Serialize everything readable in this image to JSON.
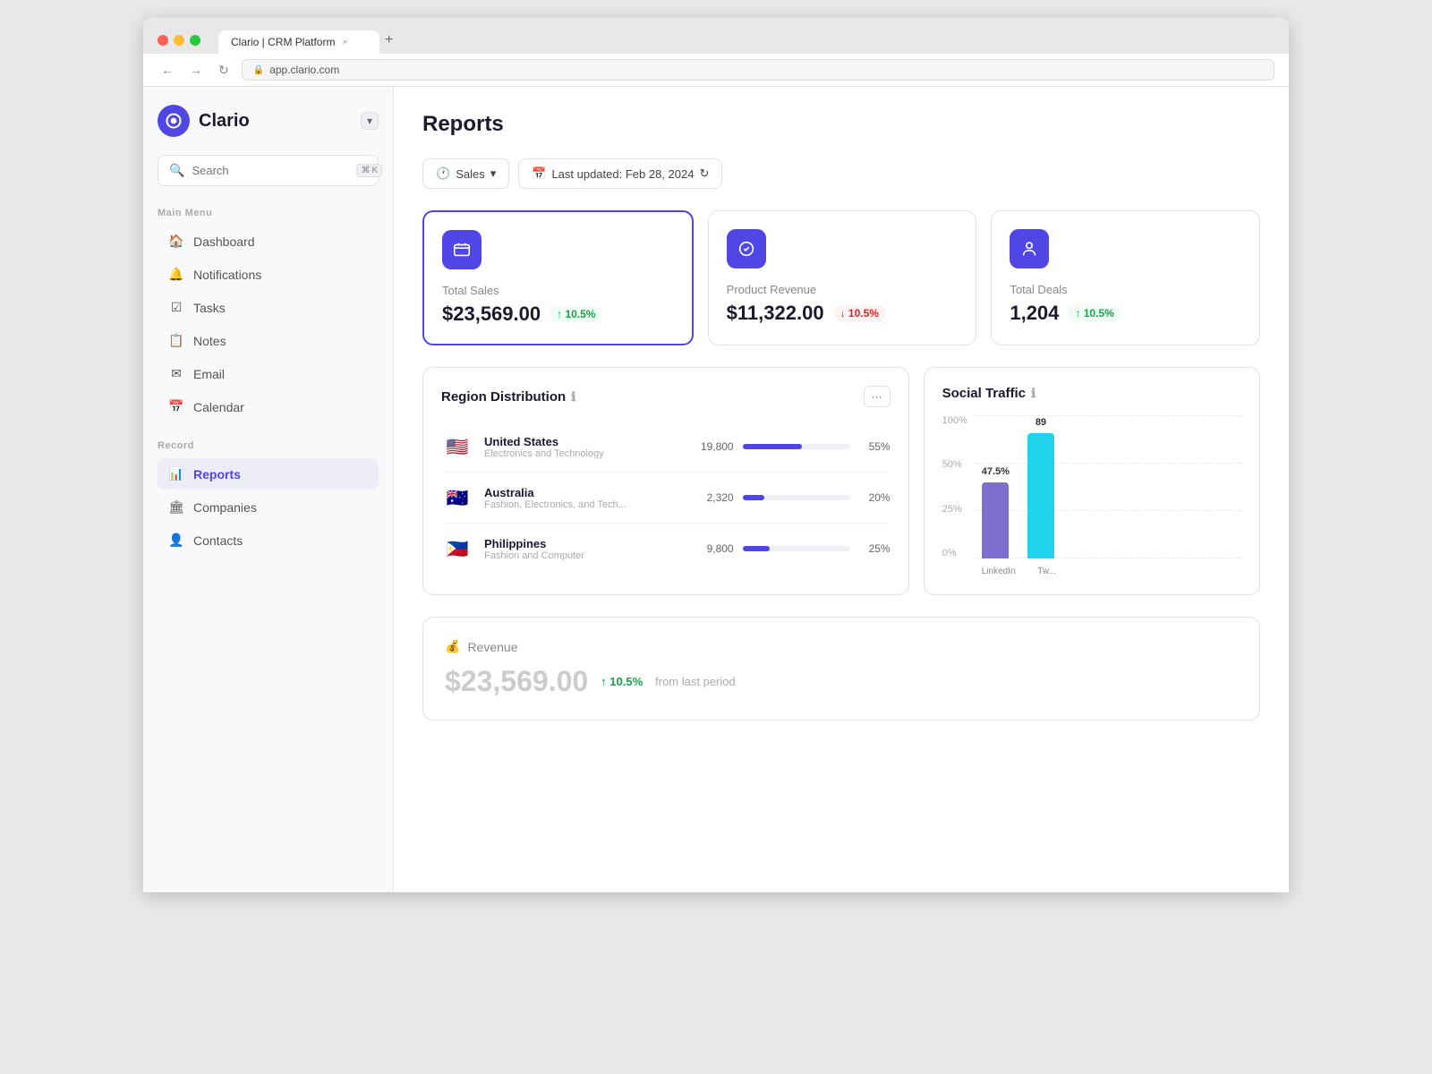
{
  "browser": {
    "tab_title": "Clario | CRM Platform",
    "tab_new_symbol": "+",
    "close_symbol": "×",
    "nav_back": "←",
    "nav_forward": "→",
    "nav_refresh": "↻",
    "address": "app.clario.com"
  },
  "sidebar": {
    "app_name": "Clario",
    "dropdown_symbol": "▾",
    "search_placeholder": "Search",
    "search_shortcut_cmd": "⌘",
    "search_shortcut_key": "K",
    "main_menu_label": "Main Menu",
    "record_label": "Record",
    "nav_items": [
      {
        "id": "dashboard",
        "label": "Dashboard",
        "icon": "🏠"
      },
      {
        "id": "notifications",
        "label": "Notifications",
        "icon": "🔔"
      },
      {
        "id": "tasks",
        "label": "Tasks",
        "icon": "☑"
      },
      {
        "id": "notes",
        "label": "Notes",
        "icon": "📋"
      },
      {
        "id": "email",
        "label": "Email",
        "icon": "✉"
      },
      {
        "id": "calendar",
        "label": "Calendar",
        "icon": "📅"
      }
    ],
    "record_items": [
      {
        "id": "reports",
        "label": "Reports",
        "icon": "📊",
        "active": true
      },
      {
        "id": "companies",
        "label": "Companies",
        "icon": "🏛"
      },
      {
        "id": "contacts",
        "label": "Contacts",
        "icon": "👤"
      }
    ]
  },
  "main": {
    "page_title": "Reports",
    "toolbar": {
      "filter_label": "Sales",
      "filter_dropdown": "▾",
      "date_label": "Last updated: Feb 28, 2024",
      "refresh_symbol": "↻"
    },
    "kpi_cards": [
      {
        "id": "total-sales",
        "label": "Total Sales",
        "value": "$23,569.00",
        "badge": "↑ 10.5%",
        "badge_type": "up",
        "active": true
      },
      {
        "id": "product-revenue",
        "label": "Product Revenue",
        "value": "$11,322.00",
        "badge": "↓ 10.5%",
        "badge_type": "down",
        "active": false
      },
      {
        "id": "total-deals",
        "label": "Total Deals",
        "value": "1,204",
        "badge": "↑ 10.5%",
        "badge_type": "up",
        "active": false
      }
    ],
    "region_distribution": {
      "title": "Region Distribution",
      "more_btn": "···",
      "rows": [
        {
          "id": "us",
          "flag": "🇺🇸",
          "name": "United States",
          "sub": "Electronics and Technology",
          "value": "19,800",
          "pct": 55,
          "pct_label": "55%"
        },
        {
          "id": "au",
          "flag": "🇦🇺",
          "name": "Australia",
          "sub": "Fashion, Electronics, and Tech...",
          "value": "2,320",
          "pct": 20,
          "pct_label": "20%"
        },
        {
          "id": "ph",
          "flag": "🇵🇭",
          "name": "Philippines",
          "sub": "Fashion and Computer",
          "value": "9,800",
          "pct": 25,
          "pct_label": "25%"
        }
      ]
    },
    "social_traffic": {
      "title": "Social Traffic",
      "y_labels": [
        "100%",
        "50%",
        "25%",
        "0%"
      ],
      "bars": [
        {
          "id": "linkedin",
          "label": "LinkedIn",
          "value": 47.5,
          "color": "#7c6fcd",
          "value_label": "47.5%"
        },
        {
          "id": "twitter",
          "label": "Tw...",
          "value": 89,
          "color": "#22d3ee",
          "value_label": "89"
        }
      ]
    },
    "revenue": {
      "section_label": "Revenue",
      "amount": "$23,569.00",
      "badge": "↑ 10.5%",
      "period_text": "from last period"
    }
  }
}
